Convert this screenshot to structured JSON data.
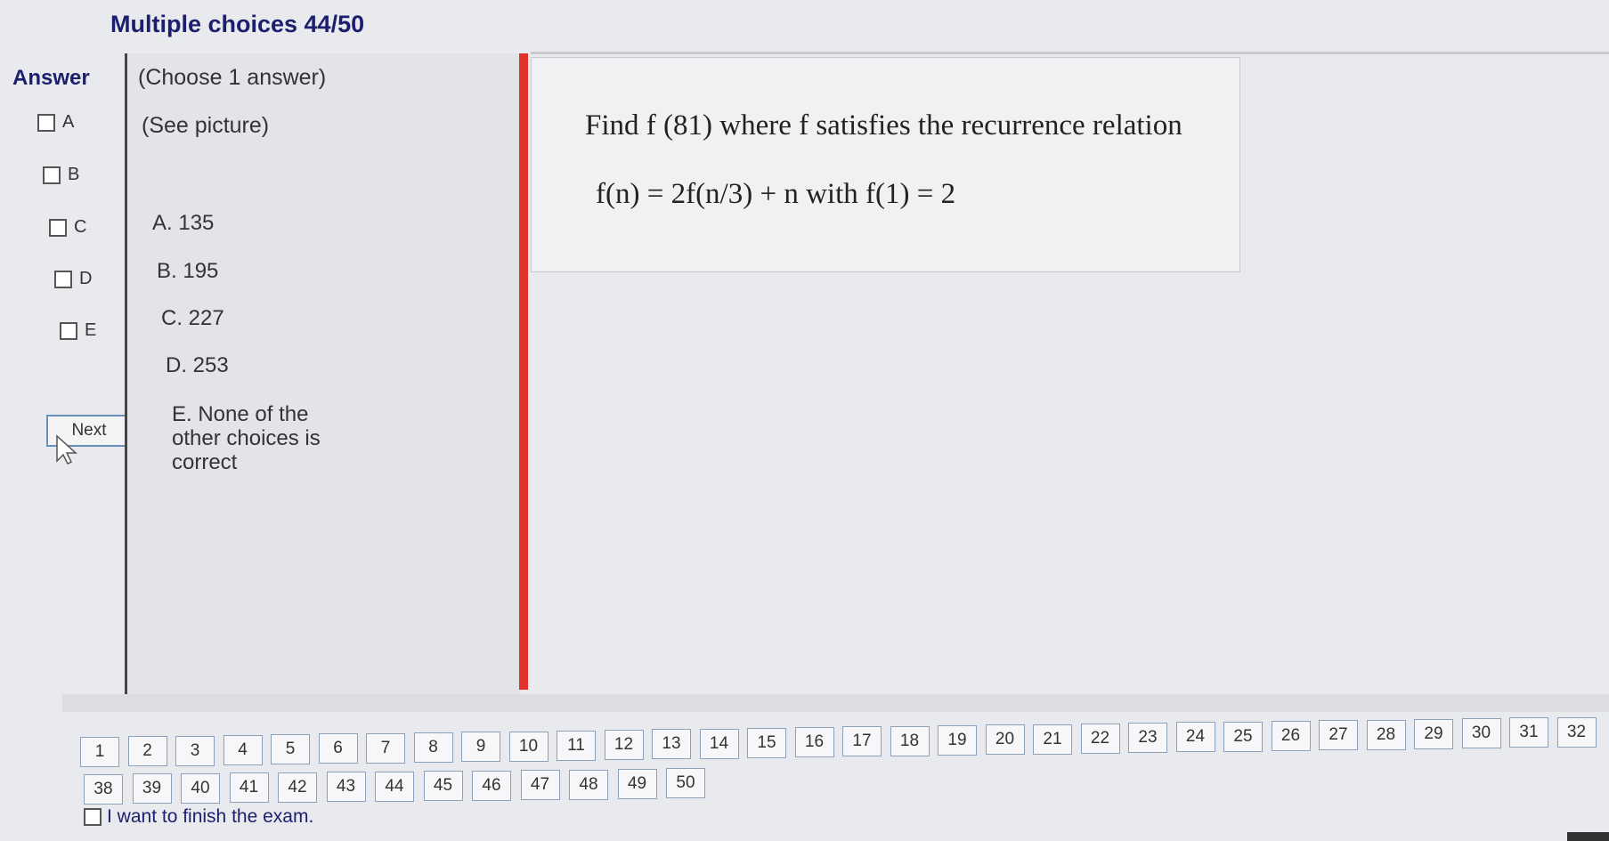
{
  "header": {
    "title": "Multiple choices 44/50"
  },
  "answer": {
    "label": "Answer",
    "options": [
      "A",
      "B",
      "C",
      "D",
      "E"
    ],
    "next_label": "Next"
  },
  "choices_panel": {
    "instruction": "(Choose 1 answer)",
    "see_picture": "(See picture)",
    "choices": [
      "A. 135",
      "B. 195",
      "C. 227",
      "D. 253"
    ],
    "choice_e": [
      "E. None of the",
      "other choices is",
      "correct"
    ]
  },
  "question": {
    "line1": "Find f (81) where f  satisfies the recurrence relation",
    "line2": "f(n) = 2f(n/3) + n with f(1) = 2"
  },
  "navigation": {
    "row1": [
      "1",
      "2",
      "3",
      "4",
      "5",
      "6",
      "7",
      "8",
      "9",
      "10",
      "11",
      "12",
      "13",
      "14",
      "15",
      "16",
      "17",
      "18",
      "19",
      "20",
      "21",
      "22",
      "23",
      "24",
      "25",
      "26",
      "27",
      "28",
      "29",
      "30",
      "31",
      "32"
    ],
    "row2": [
      "38",
      "39",
      "40",
      "41",
      "42",
      "43",
      "44",
      "45",
      "46",
      "47",
      "48",
      "49",
      "50"
    ]
  },
  "finish": {
    "label": "I want to finish the exam."
  }
}
